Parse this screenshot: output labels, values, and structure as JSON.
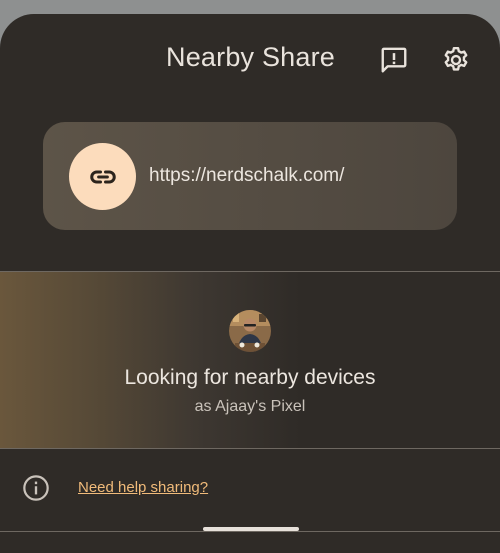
{
  "header": {
    "title": "Nearby Share",
    "icons": [
      "feedback-icon",
      "gear-icon"
    ]
  },
  "shared_item": {
    "icon": "link-icon",
    "url": "https://nerdschalk.com/"
  },
  "devices": {
    "status": "Looking for nearby devices",
    "device_name": "as Ajaay's Pixel"
  },
  "help": {
    "icon": "info-icon",
    "link_text": "Need help sharing?"
  },
  "colors": {
    "sheet_background": "#2f2b27",
    "card_background": "#5a5146",
    "link_circle": "#fcdcbc",
    "help_link": "#f1bb7a"
  }
}
